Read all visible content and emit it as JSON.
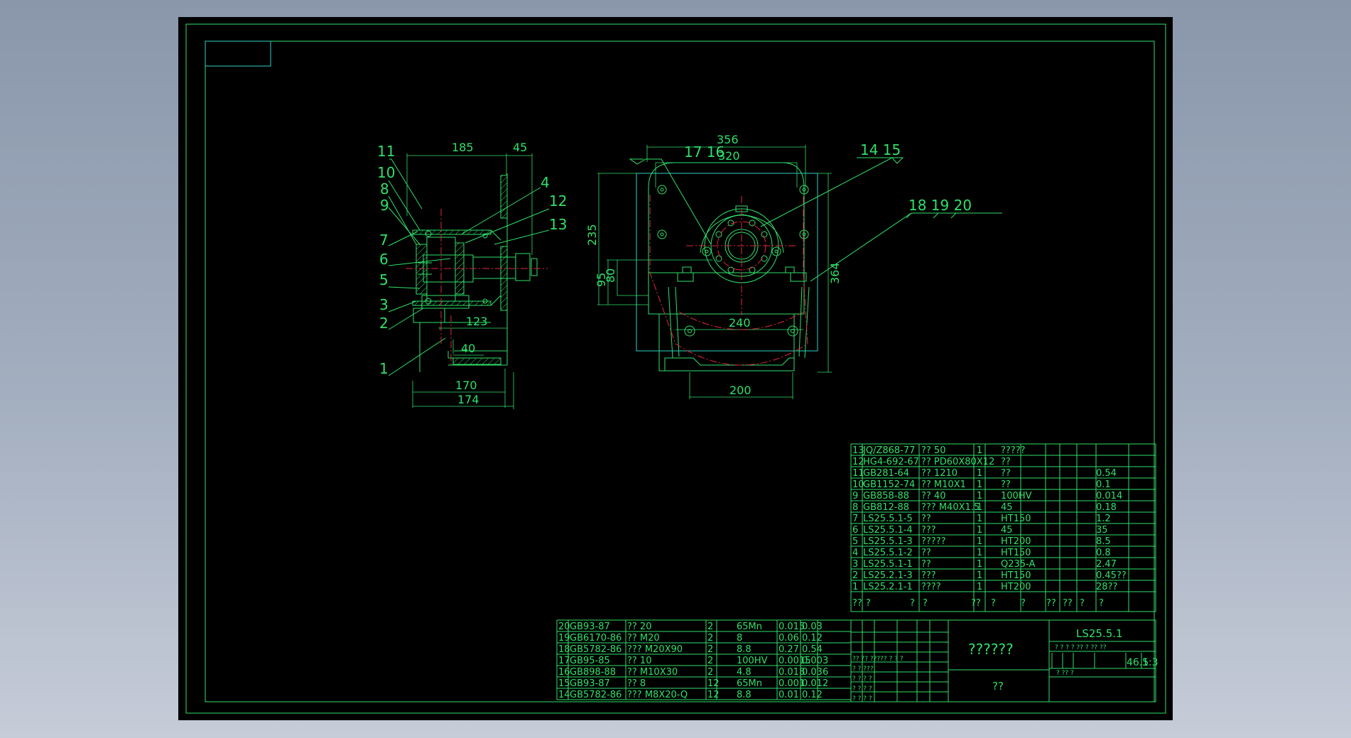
{
  "colors": {
    "green": "#2fe06a",
    "cyan": "#2fd0c8",
    "red": "#e0283a",
    "white": "#e8e8e8",
    "paper": "#000000"
  },
  "left_view": {
    "dims": {
      "d185": "185",
      "d45": "45",
      "d123": "123",
      "d40": "40",
      "d170": "170",
      "d174": "174"
    },
    "balloons": [
      "11",
      "10",
      "8",
      "9",
      "7",
      "6",
      "5",
      "3",
      "2",
      "1",
      "4",
      "12",
      "13"
    ]
  },
  "right_view": {
    "dims": {
      "d356": "356",
      "d320": "320",
      "d235": "235",
      "d95": "95",
      "d80": "80",
      "d364": "364",
      "d240": "240",
      "d200": "200"
    },
    "balloons": {
      "b1716": "17 16",
      "b1415": "14 15",
      "b181920": "18 19 20"
    }
  },
  "bom_upper": [
    {
      "no": "13",
      "code": "JQ/Z868-77",
      "name": "?? 50",
      "qty": "1",
      "mat": "?????",
      "w": ""
    },
    {
      "no": "12",
      "code": "HG4-692-67",
      "name": "?? PD60X80X12",
      "qty": "",
      "mat": "??",
      "w": ""
    },
    {
      "no": "11",
      "code": "GB281-64",
      "name": "?? 1210",
      "qty": "1",
      "mat": "??",
      "w": "0.54"
    },
    {
      "no": "10",
      "code": "GB1152-74",
      "name": "?? M10X1",
      "qty": "1",
      "mat": "??",
      "w": "0.1"
    },
    {
      "no": "9",
      "code": "GB858-88",
      "name": "?? 40",
      "qty": "1",
      "mat": "100HV",
      "w": "0.014"
    },
    {
      "no": "8",
      "code": "GB812-88",
      "name": "??? M40X1.5",
      "qty": "1",
      "mat": "45",
      "w": "0.18"
    },
    {
      "no": "7",
      "code": "LS25.5.1-5",
      "name": "??",
      "qty": "1",
      "mat": "HT150",
      "w": "1.2"
    },
    {
      "no": "6",
      "code": "LS25.5.1-4",
      "name": "???",
      "qty": "1",
      "mat": "45",
      "w": "35"
    },
    {
      "no": "5",
      "code": "LS25.5.1-3",
      "name": "?????",
      "qty": "1",
      "mat": "HT200",
      "w": "8.5"
    },
    {
      "no": "4",
      "code": "LS25.5.1-2",
      "name": "??",
      "qty": "1",
      "mat": "HT150",
      "w": "0.8"
    },
    {
      "no": "3",
      "code": "LS25.5.1-1",
      "name": "??",
      "qty": "1",
      "mat": "Q235-A",
      "w": "2.47"
    },
    {
      "no": "2",
      "code": "LS25.2.1-3",
      "name": "???",
      "qty": "1",
      "mat": "HT150",
      "w": "0.45??"
    },
    {
      "no": "1",
      "code": "LS25.2.1-1",
      "name": "????",
      "qty": "1",
      "mat": "HT200",
      "w": "28??"
    }
  ],
  "bom_header": [
    "??",
    "?",
    "?",
    "?",
    "??",
    "?",
    "?",
    "??",
    "??",
    "?",
    "?"
  ],
  "bom_lower": [
    {
      "no": "20",
      "code": "GB93-87",
      "name": "?? 20",
      "qty": "2",
      "mat": "65Mn",
      "u": "0.015",
      "t": "0.03"
    },
    {
      "no": "19",
      "code": "GB6170-86",
      "name": "?? M20",
      "qty": "2",
      "mat": "8",
      "u": "0.06",
      "t": "0.12"
    },
    {
      "no": "18",
      "code": "GB5782-86",
      "name": "??? M20X90",
      "qty": "2",
      "mat": "8.8",
      "u": "0.27",
      "t": "0.54"
    },
    {
      "no": "17",
      "code": "GB95-85",
      "name": "?? 10",
      "qty": "2",
      "mat": "100HV",
      "u": "0.0015",
      "t": "0.003"
    },
    {
      "no": "16",
      "code": "GB898-88",
      "name": "?? M10X30",
      "qty": "2",
      "mat": "4.8",
      "u": "0.018",
      "t": "0.036"
    },
    {
      "no": "15",
      "code": "GB93-87",
      "name": "?? 8",
      "qty": "12",
      "mat": "65Mn",
      "u": "0.001",
      "t": "0.012"
    },
    {
      "no": "14",
      "code": "GB5782-86",
      "name": "??? M8X20-Q",
      "qty": "12",
      "mat": "8.8",
      "u": "0.01",
      "t": "0.12"
    }
  ],
  "title_block": {
    "drawing_title": "??????",
    "drawing_no": "LS25.5.1",
    "company": "??",
    "mark_row": "? ? ? ? ?? ? ?? ??",
    "weight": "46.5",
    "scale": "1:3",
    "sheet_row": "?        ??   ?",
    "rev_rows": [
      "?? ??  ?????  ?  ? ?",
      "?  ?       ???",
      "?  ?       ? ?",
      "?  ?       ? ?",
      "?  ?       ? ?"
    ]
  }
}
